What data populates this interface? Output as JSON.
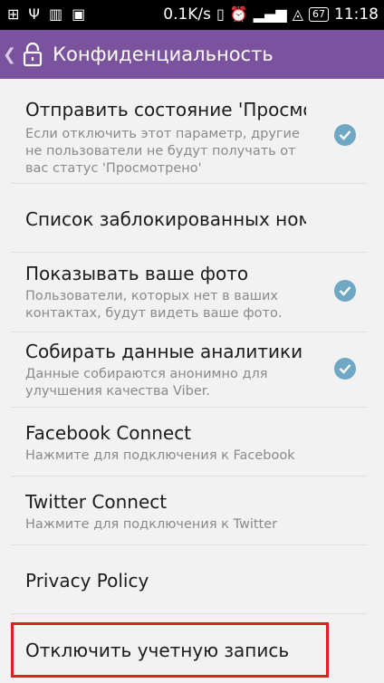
{
  "status": {
    "speed": "0.1K/s",
    "battery": "67",
    "time": "11:18"
  },
  "appbar": {
    "title": "Конфиденциальность"
  },
  "rows": [
    {
      "title": "Отправить состояние 'Просмотрено'",
      "subtitle": "Если отключить этот параметр, другие не пользователи не будут получать от вас статус 'Просмотрено'",
      "checked": true
    },
    {
      "title": "Список заблокированных номеров"
    },
    {
      "title": "Показывать ваше фото",
      "subtitle": "Пользователи, которых нет в ваших контактах, будут видеть ваше фото.",
      "checked": true
    },
    {
      "title": "Собирать данные аналитики",
      "subtitle": "Данные собираются анонимно для улучшения качества Viber.",
      "checked": true
    },
    {
      "title": "Facebook Connect",
      "subtitle": "Нажмите для подключения к Facebook"
    },
    {
      "title": "Twitter Connect",
      "subtitle": "Нажмите для подключения к Twitter"
    },
    {
      "title": "Privacy Policy"
    },
    {
      "title": "Отключить учетную запись"
    }
  ],
  "colors": {
    "appbar": "#7b529d",
    "check": "#6fa8c4",
    "highlight": "#e02020"
  }
}
